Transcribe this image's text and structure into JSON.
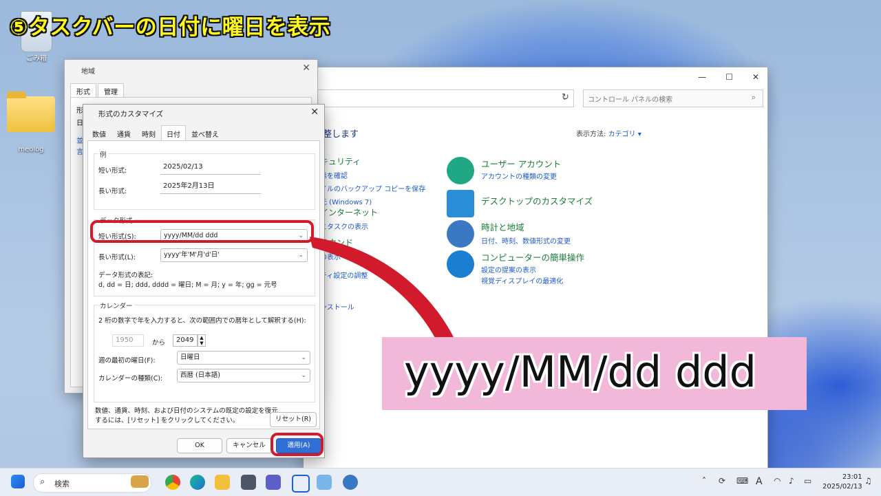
{
  "banner": "⑤タスクバーの日付に曜日を表示",
  "desktop": {
    "recycle_label": "ごみ箱",
    "folder_label": "meolog"
  },
  "control_panel": {
    "search_placeholder": "コントロール パネルの検索",
    "heading": "整します",
    "view_by_label": "表示方法:",
    "view_by_value": "カテゴリ ▾",
    "left_groups": [
      {
        "title": "キュリティ",
        "links": [
          "態を確認",
          "イルのバックアップ コピーを保存",
          "元 (Windows 7)"
        ]
      },
      {
        "title": "インターネット",
        "links": [
          "とタスクの表示"
        ]
      },
      {
        "title": "サウンド",
        "links": [
          "の表示"
        ]
      },
      {
        "title": "",
        "links": [
          "ティ設定の調整"
        ]
      },
      {
        "title": "",
        "links": [
          "ンストール"
        ]
      }
    ],
    "categories": [
      {
        "title": "ユーザー アカウント",
        "links": [
          "アカウントの種類の変更"
        ]
      },
      {
        "title": "デスクトップのカスタマイズ",
        "links": []
      },
      {
        "title": "時計と地域",
        "links": [
          "日付、時刻、数値形式の変更"
        ]
      },
      {
        "title": "コンピューターの簡単操作",
        "links": [
          "設定の提案の表示",
          "視覚ディスプレイの最適化"
        ]
      }
    ]
  },
  "region_dialog": {
    "title": "地域",
    "tabs": [
      "形式",
      "管理"
    ],
    "side_text": [
      "形",
      "日",
      "並",
      "言"
    ]
  },
  "customize_dialog": {
    "title": "形式のカスタマイズ",
    "tabs": [
      "数値",
      "通貨",
      "時刻",
      "日付",
      "並べ替え"
    ],
    "example_group": "例",
    "short_label": "短い形式:",
    "short_value": "2025/02/13",
    "long_label": "長い形式:",
    "long_value": "2025年2月13日",
    "format_group": "データ形式",
    "short_fmt_label": "短い形式(S):",
    "short_fmt_value": "yyyy/MM/dd ddd",
    "long_fmt_label": "長い形式(L):",
    "long_fmt_value": "yyyy'年'M'月'd'日'",
    "notation_title": "データ形式の表記:",
    "notation_text": "d, dd = 日;  ddd, dddd = 曜日; M = 月; y = 年; gg = 元号",
    "calendar_group": "カレンダー",
    "calendar_desc": "2 桁の数字で年を入力すると、次の範囲内での暦年として解釈する(H):",
    "year_from": "1950",
    "year_sep": "から",
    "year_to": "2049",
    "first_day_label": "週の最初の曜日(F):",
    "first_day_value": "日曜日",
    "calendar_type_label": "カレンダーの種類(C):",
    "calendar_type_value": "西暦 (日本語)",
    "reset_text_1": "数値、通貨、時刻、および日付のシステムの既定の設定を復元",
    "reset_text_2": "するには、[リセット] をクリックしてください。",
    "reset_button": "リセット(R)",
    "ok_button": "OK",
    "cancel_button": "キャンセル",
    "apply_button": "適用(A)"
  },
  "callout": "yyyy/MM/dd ddd",
  "taskbar": {
    "search_label": "検索",
    "time": "23:01",
    "date": "2025/02/13",
    "ime": "A"
  }
}
